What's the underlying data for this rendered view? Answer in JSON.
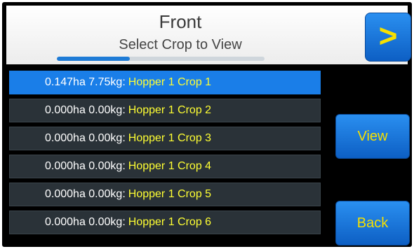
{
  "header": {
    "title": "Front",
    "subtitle": "Select Crop to View",
    "progress_fraction": 0.35,
    "next_label": ">"
  },
  "crops": [
    {
      "stats": "0.147ha 7.75kg:",
      "name": "Hopper 1 Crop 1",
      "selected": true
    },
    {
      "stats": "0.000ha 0.00kg:",
      "name": "Hopper 1 Crop 2",
      "selected": false
    },
    {
      "stats": "0.000ha 0.00kg:",
      "name": "Hopper 1 Crop 3",
      "selected": false
    },
    {
      "stats": "0.000ha 0.00kg:",
      "name": "Hopper 1 Crop 4",
      "selected": false
    },
    {
      "stats": "0.000ha 0.00kg:",
      "name": "Hopper 1 Crop 5",
      "selected": false
    },
    {
      "stats": "0.000ha 0.00kg:",
      "name": "Hopper 1 Crop 6",
      "selected": false
    }
  ],
  "buttons": {
    "view_label": "View",
    "back_label": "Back"
  },
  "colors": {
    "accent": "#1a7ee8",
    "crop_text": "#ffff33",
    "button_text": "#f6e000"
  }
}
